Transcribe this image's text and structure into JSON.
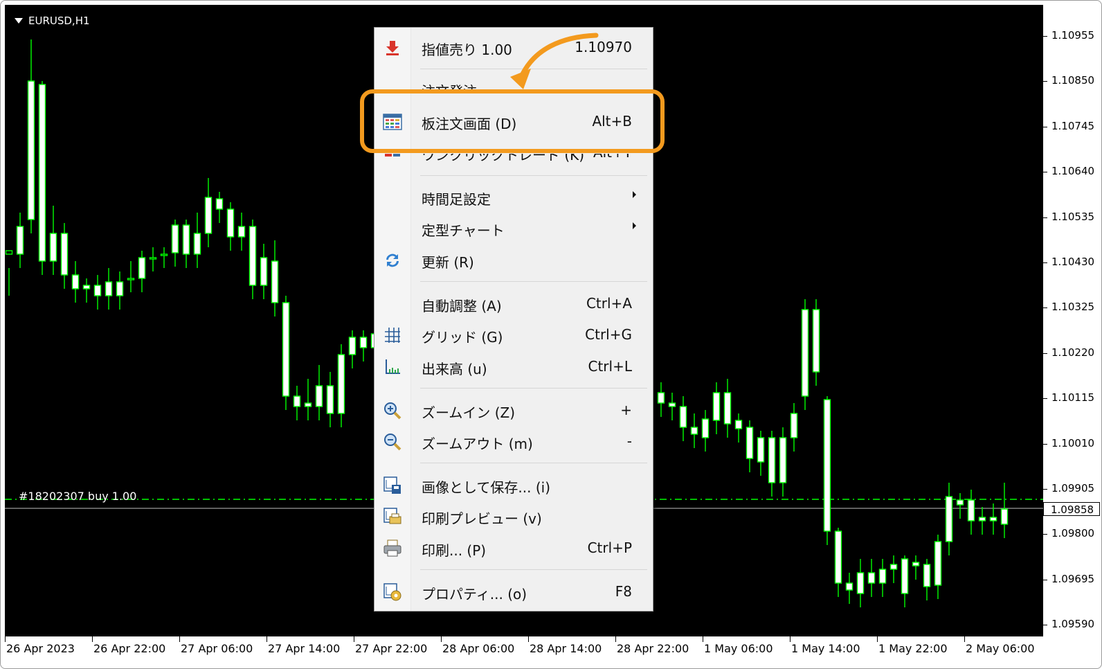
{
  "chart": {
    "symbol": "EURUSD,H1",
    "order_label": "#18202307 buy 1.00",
    "current_price": "1.09858",
    "price_labels": [
      "1.10955",
      "1.10850",
      "1.10745",
      "1.10640",
      "1.10535",
      "1.10430",
      "1.10325",
      "1.10220",
      "1.10115",
      "1.10010",
      "1.09905",
      "1.09800",
      "1.09695",
      "1.09590"
    ],
    "time_labels": [
      "26 Apr 2023",
      "26 Apr 22:00",
      "27 Apr 06:00",
      "27 Apr 14:00",
      "27 Apr 22:00",
      "28 Apr 06:00",
      "28 Apr 14:00",
      "28 Apr 22:00",
      "1 May 06:00",
      "1 May 14:00",
      "1 May 22:00",
      "2 May 06:00"
    ],
    "colors": {
      "background": "#000000",
      "candle": "#00ff00",
      "bull_body": "#000000",
      "bear_body": "#ffffff",
      "order_line": "#00ff00",
      "bid_line": "#c0c0c0"
    }
  },
  "menu": {
    "items": [
      {
        "label": "指値売り 1.00",
        "shortcut": "1.10970",
        "icon": "sell-limit-icon"
      },
      {
        "label": "注文発注",
        "shortcut": "",
        "icon": "",
        "obscured": true
      },
      {
        "label": "板注文画面 (D)",
        "shortcut": "Alt+B",
        "icon": "depth-of-market-icon",
        "highlighted": true
      },
      {
        "label": "ワンクリックトレード (K)",
        "shortcut": "Alt+T",
        "icon": "one-click-trading-icon",
        "obscured": true
      },
      {
        "label": "時間足設定",
        "shortcut": "",
        "icon": "",
        "submenu": true
      },
      {
        "label": "定型チャート",
        "shortcut": "",
        "icon": "",
        "submenu": true
      },
      {
        "label": "更新 (R)",
        "shortcut": "",
        "icon": "refresh-icon"
      },
      {
        "label": "自動調整 (A)",
        "shortcut": "Ctrl+A",
        "icon": ""
      },
      {
        "label": "グリッド (G)",
        "shortcut": "Ctrl+G",
        "icon": "grid-icon"
      },
      {
        "label": "出来高 (u)",
        "shortcut": "Ctrl+L",
        "icon": "volumes-icon"
      },
      {
        "label": "ズームイン (Z)",
        "shortcut": "+",
        "icon": "zoom-in-icon"
      },
      {
        "label": "ズームアウト (m)",
        "shortcut": "-",
        "icon": "zoom-out-icon"
      },
      {
        "label": "画像として保存... (i)",
        "shortcut": "",
        "icon": "save-image-icon"
      },
      {
        "label": "印刷プレビュー (v)",
        "shortcut": "",
        "icon": "print-preview-icon"
      },
      {
        "label": "印刷... (P)",
        "shortcut": "Ctrl+P",
        "icon": "print-icon"
      },
      {
        "label": "プロパティ... (o)",
        "shortcut": "F8",
        "icon": "properties-icon"
      }
    ]
  },
  "annotation": {
    "highlight_color": "#f39a1e"
  }
}
